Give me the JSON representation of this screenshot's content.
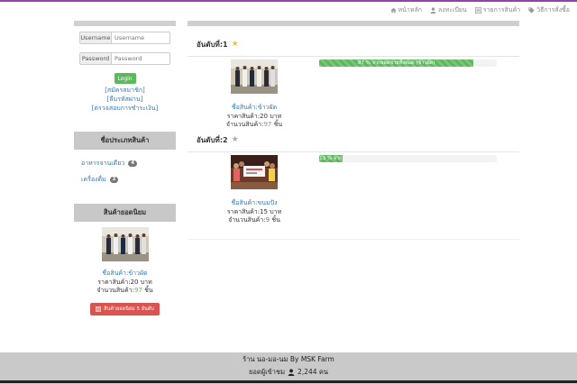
{
  "nav": {
    "home": "หน้าหลัก",
    "register": "ลงทะเบียน",
    "products": "รายการสินค้า",
    "how_to_buy": "วิธีการสั่งซื้อ"
  },
  "login": {
    "username_label": "Username",
    "username_placeholder": "Username",
    "password_label": "Password",
    "password_placeholder": "Password",
    "button": "Login",
    "links": [
      "[สมัครสมาชิก]",
      "[ลืมรหัสผ่าน]",
      "[ตรวจสอบการชำระเงิน]"
    ]
  },
  "categories": {
    "title": "ชื่อประเภทสินค้า",
    "items": [
      {
        "label": "อาหารจานเดียว",
        "count": "4"
      },
      {
        "label": "เครื่องดื่ม",
        "count": "2"
      }
    ]
  },
  "popular": {
    "title": "สินค้ายอดนิยม",
    "name": "ชื่อสินค้า:ข้าวผัด",
    "price": "ราคาสินค้า:20 บาท",
    "qty_label": "จำนวนสินค้า:",
    "qty_value": "97",
    "qty_unit": " ชิ้น",
    "button": "สินค้ายอดนิยม 5 อันดับ"
  },
  "ranks": [
    {
      "title": "อันดับที่:1",
      "star": "gold",
      "name": "ชื่อสินค้า:ข้าวผัด",
      "price": "ราคาสินค้า:20 บาท",
      "qty_label": "จำนวนสินค้า:",
      "qty_value": "97",
      "qty_unit": " ชิ้น",
      "progress_percent": 87,
      "progress_text": "87 % จากยอดขายทั้งหมด (ข้าวผัด)"
    },
    {
      "title": "อันดับที่:2",
      "star": "grey",
      "name": "ชื่อสินค้า:ขนมปัง",
      "price": "ราคาสินค้า:15 บาท",
      "qty_label": "จำนวนสินค้า:",
      "qty_value": "9",
      "qty_unit": " ชิ้น",
      "progress_percent": 13,
      "progress_text": "13 % จาก"
    }
  ],
  "footer": {
    "line1": "ร้าน นอ-มอ-นม By MSK Farm",
    "visits_label": "ยอดผู้เข้าชม",
    "visits_count": "2,244 คน"
  },
  "colors": {
    "accent": "#8e44ad",
    "success": "#5cb85c",
    "danger": "#d9534f",
    "link": "#337ab7"
  }
}
